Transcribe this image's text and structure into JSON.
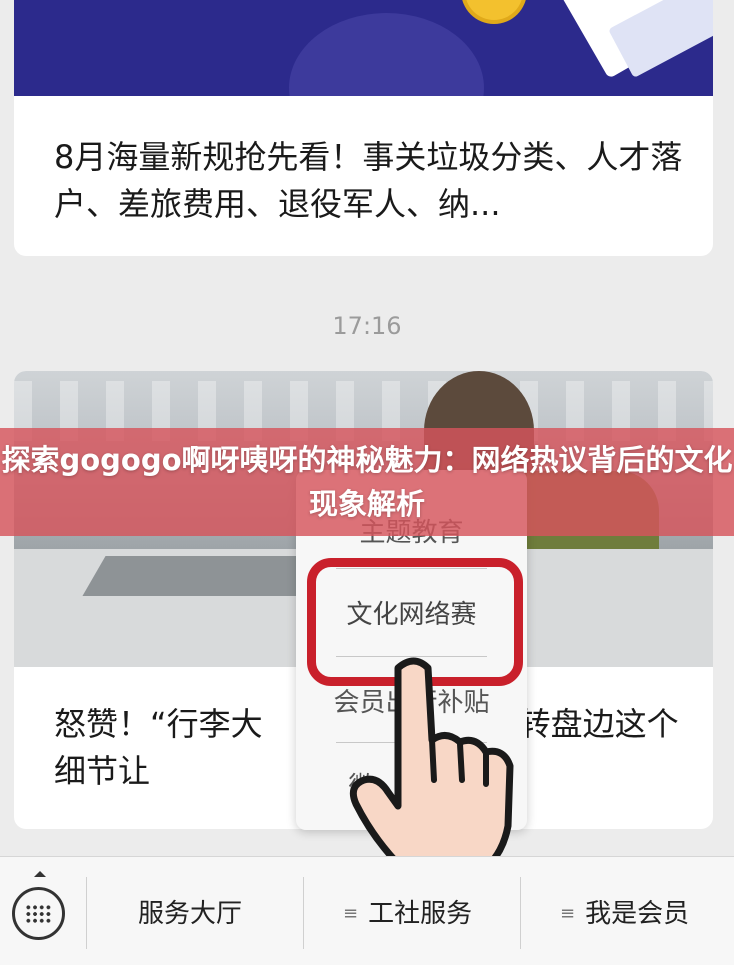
{
  "feed": {
    "card1_title": "8月海量新规抢先看！事关垃圾分类、人才落户、差旅费用、退役军人、纳...",
    "timestamp": "17:16",
    "card2_title": "怒赞！“行李大　　　　　机场，转盘边这个细节让"
  },
  "popup": {
    "items": [
      "主题教育",
      "文化网络赛",
      "会员出行补贴",
      "微"
    ]
  },
  "overlay": {
    "headline": "探索gogogo啊呀咦呀的神秘魅力：网络热议背后的文化现象解析"
  },
  "bottombar": {
    "tab1": "服务大厅",
    "tab2": "工社服务",
    "tab3": "我是会员",
    "menu_glyph": "≡"
  },
  "colors": {
    "highlight": "#c9202b",
    "overlay": "#d6545c",
    "banner": "#2c2a8c"
  }
}
